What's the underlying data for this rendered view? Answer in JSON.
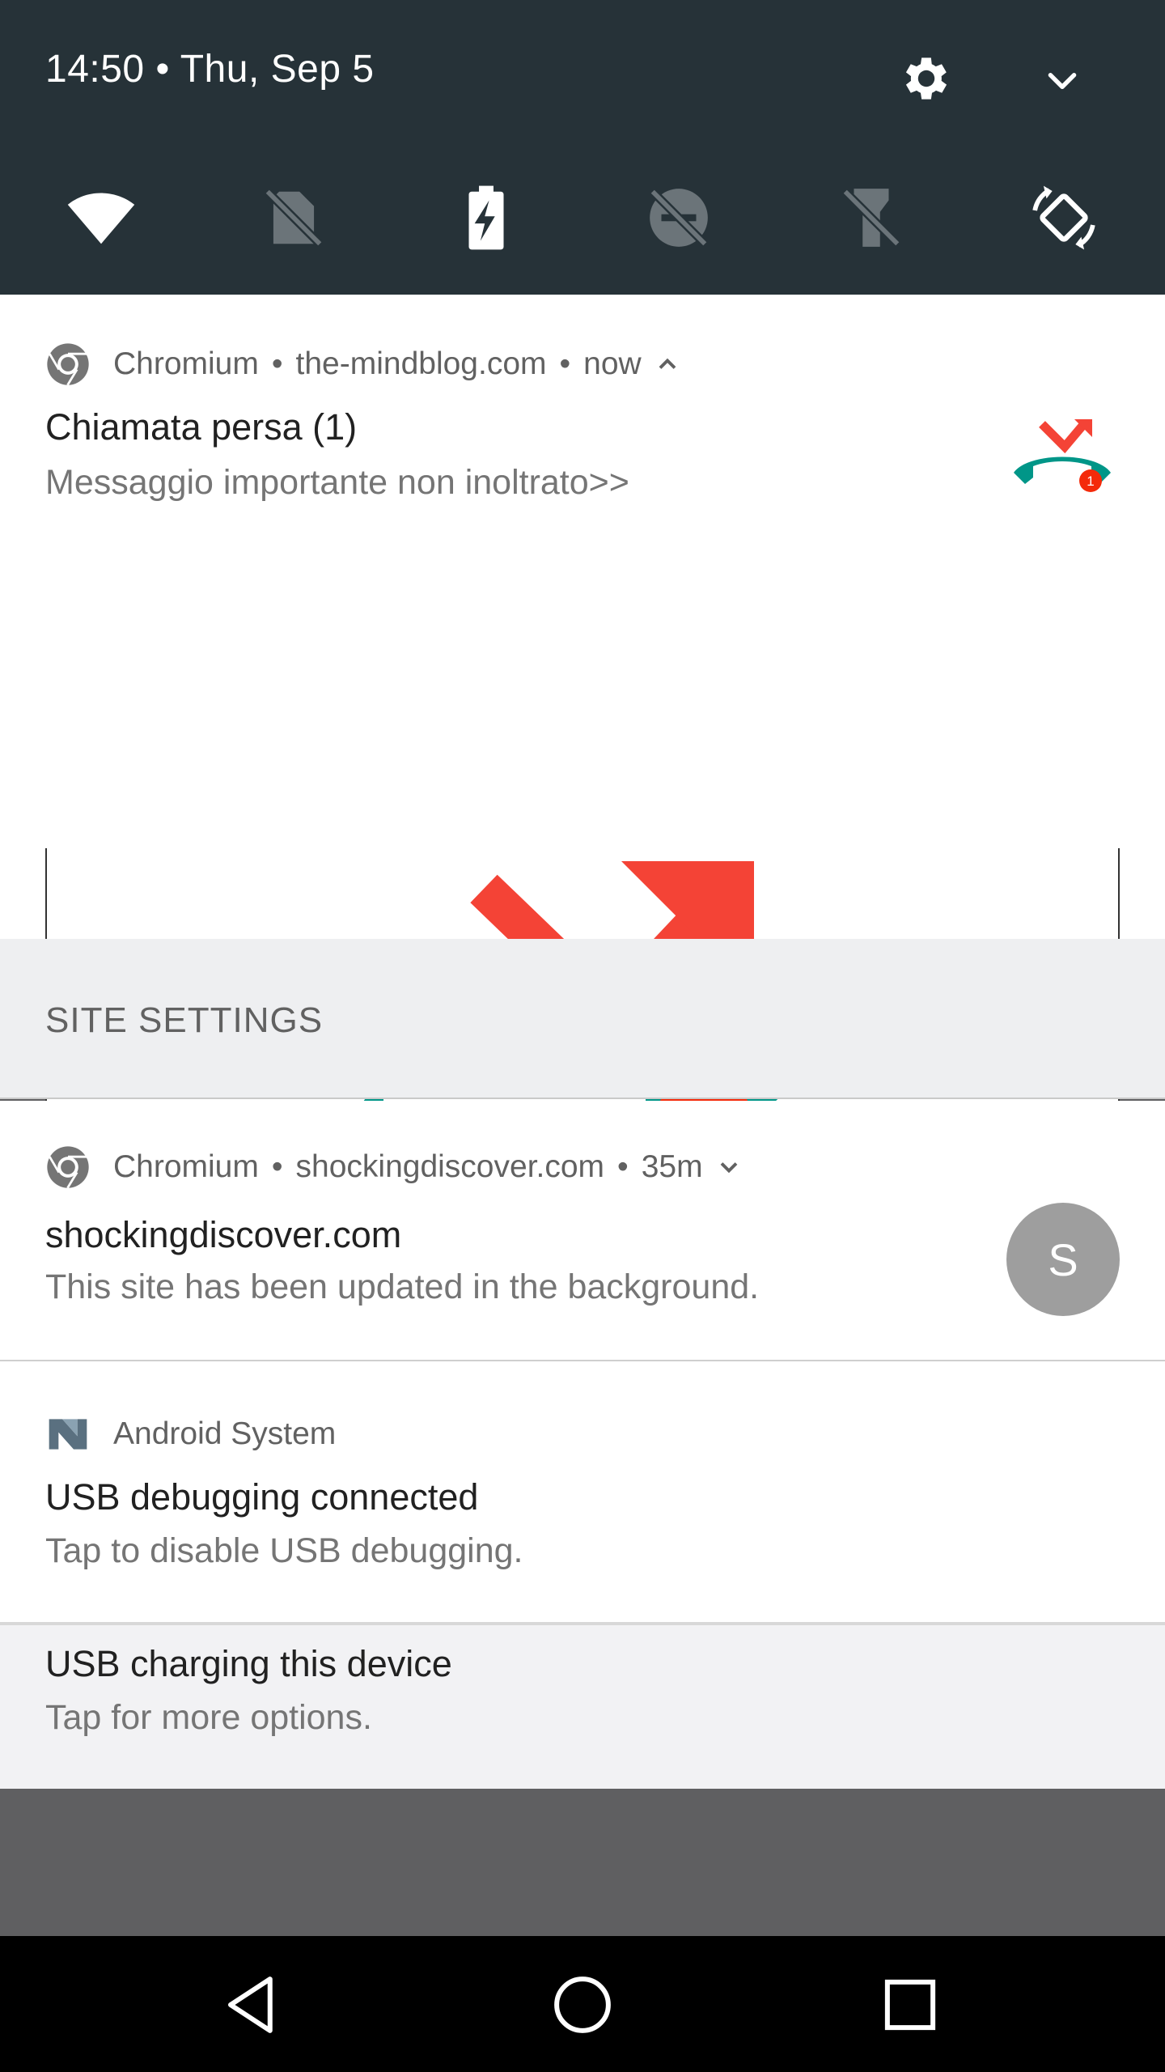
{
  "status": {
    "time_date": "14:50 • Thu, Sep 5",
    "settings_icon": "gear-icon",
    "expand_icon": "chevron-down-icon"
  },
  "quick_tiles": [
    {
      "name": "wifi-icon",
      "active": true
    },
    {
      "name": "no-sim-icon",
      "active": false
    },
    {
      "name": "battery-charging-icon",
      "active": true
    },
    {
      "name": "do-not-disturb-off-icon",
      "active": false
    },
    {
      "name": "flashlight-off-icon",
      "active": false
    },
    {
      "name": "auto-rotate-icon",
      "active": true
    }
  ],
  "notif1": {
    "app": "Chromium",
    "site": "the-mindblog.com",
    "time": "now",
    "title": "Chiamata persa (1)",
    "body": "Messaggio importante non inoltrato>>",
    "badge": "1"
  },
  "site_settings": {
    "label": "SITE SETTINGS"
  },
  "notif2": {
    "app": "Chromium",
    "site": "shockingdiscover.com",
    "time": "35m",
    "title": "shockingdiscover.com",
    "body": "This site has been updated in the background.",
    "avatar_letter": "S"
  },
  "notif3": {
    "app": "Android System",
    "title": "USB debugging connected",
    "body": "Tap to disable USB debugging."
  },
  "notif4": {
    "title": "USB charging this device",
    "body": "Tap for more options."
  },
  "colors": {
    "header_bg": "#263238",
    "phone_green": "#009688",
    "missed_red": "#f44336",
    "badge_red": "#f42a0a"
  }
}
